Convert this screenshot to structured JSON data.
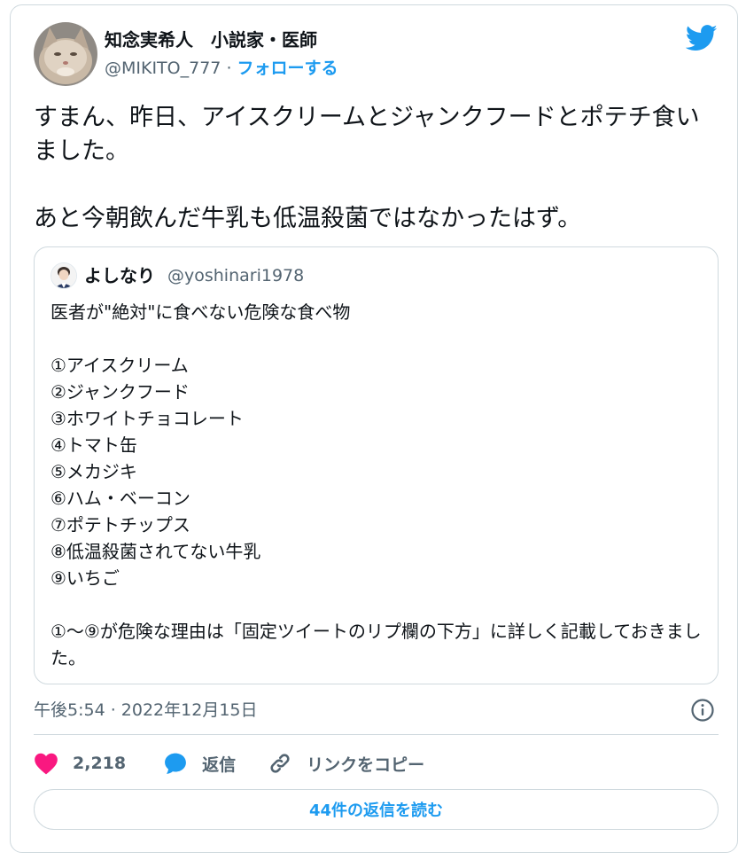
{
  "author": {
    "name": "知念実希人　小説家・医師",
    "handle": "@MIKITO_777",
    "separator": "·",
    "follow_label": "フォローする"
  },
  "tweet": {
    "text": "すまん、昨日、アイスクリームとジャンクフードとポテチ食いました。\n\nあと今朝飲んだ牛乳も低温殺菌ではなかったはず。"
  },
  "quote": {
    "name": "よしなり",
    "handle": "@yoshinari1978",
    "text": "医者が\"絶対\"に食べない危険な食べ物\n\n①アイスクリーム\n②ジャンクフード\n③ホワイトチョコレート\n④トマト缶\n⑤メカジキ\n⑥ハム・ベーコン\n⑦ポテトチップス\n⑧低温殺菌されてない牛乳\n⑨いちご\n\n①～⑨が危険な理由は「固定ツイートのリプ欄の下方」に詳しく記載しておきました。"
  },
  "meta": {
    "timestamp": "午後5:54 · 2022年12月15日"
  },
  "actions": {
    "like_count": "2,218",
    "reply_label": "返信",
    "copy_link_label": "リンクをコピー"
  },
  "footer": {
    "read_replies_label": "44件の返信を読む"
  },
  "colors": {
    "accent": "#1d9bf0",
    "like": "#f91880",
    "text_primary": "#0f1419",
    "text_secondary": "#536471",
    "border": "#cfd9de"
  },
  "icons": {
    "brand": "twitter-bird-icon",
    "info": "info-icon",
    "like": "heart-icon",
    "reply": "speech-bubble-icon",
    "copy_link": "link-icon"
  }
}
